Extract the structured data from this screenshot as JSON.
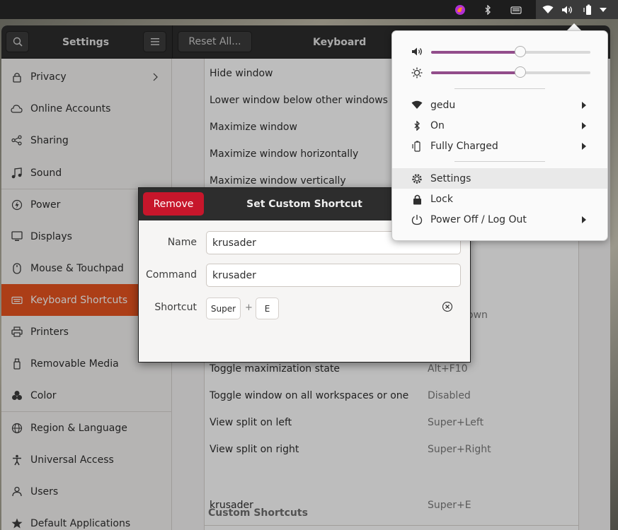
{
  "topbar": {
    "icons": [
      "firefox-icon",
      "bluetooth-icon",
      "keyboard-icon",
      "wifi-icon",
      "volume-icon",
      "battery-icon",
      "chevron-down-icon"
    ]
  },
  "headerbar": {
    "settings_title": "Settings",
    "reset_label": "Reset All...",
    "panel_title": "Keyboard"
  },
  "sidebar": {
    "items": [
      {
        "label": "Privacy",
        "icon": "hand-icon"
      },
      {
        "label": "Online Accounts",
        "icon": "cloud-icon"
      },
      {
        "label": "Sharing",
        "icon": "share-icon"
      },
      {
        "label": "Sound",
        "icon": "music-note-icon"
      },
      {
        "label": "Power",
        "icon": "power-icon"
      },
      {
        "label": "Displays",
        "icon": "display-icon"
      },
      {
        "label": "Mouse & Touchpad",
        "icon": "mouse-icon"
      },
      {
        "label": "Keyboard Shortcuts",
        "icon": "keyboard-icon"
      },
      {
        "label": "Printers",
        "icon": "printer-icon"
      },
      {
        "label": "Removable Media",
        "icon": "usb-icon"
      },
      {
        "label": "Color",
        "icon": "color-icon"
      },
      {
        "label": "Region & Language",
        "icon": "globe-icon"
      },
      {
        "label": "Universal Access",
        "icon": "accessibility-icon"
      },
      {
        "label": "Users",
        "icon": "users-icon"
      },
      {
        "label": "Default Applications",
        "icon": "star-icon"
      }
    ],
    "active_index": 7
  },
  "shortcuts": {
    "rows": [
      {
        "name": "Hide window",
        "shortcut": ""
      },
      {
        "name": "Lower window below other windows",
        "shortcut": ""
      },
      {
        "name": "Maximize window",
        "shortcut": ""
      },
      {
        "name": "Maximize window horizontally",
        "shortcut": ""
      },
      {
        "name": "Maximize window vertically",
        "shortcut": ""
      },
      {
        "name": "Toggle maximization state",
        "shortcut": "Alt+F10"
      },
      {
        "name": "Toggle window on all workspaces or one",
        "shortcut": "Disabled"
      },
      {
        "name": "View split on left",
        "shortcut": "Super+Left"
      },
      {
        "name": "View split on right",
        "shortcut": "Super+Right"
      }
    ],
    "partial_visible_text": "own",
    "custom_header": "Custom Shortcuts",
    "custom_rows": [
      {
        "name": "krusader",
        "shortcut": "Super+E"
      }
    ]
  },
  "dialog": {
    "remove_label": "Remove",
    "title": "Set Custom Shortcut",
    "name_label": "Name",
    "name_value": "krusader",
    "command_label": "Command",
    "command_value": "krusader",
    "shortcut_label": "Shortcut",
    "key1": "Super",
    "plus": "+",
    "key2": "E"
  },
  "system_menu": {
    "volume_level": 0.56,
    "brightness_level": 0.56,
    "accent": "#924d8b",
    "wifi": "gedu",
    "bluetooth": "On",
    "battery": "Fully Charged",
    "settings": "Settings",
    "lock": "Lock",
    "power": "Power Off / Log Out"
  }
}
